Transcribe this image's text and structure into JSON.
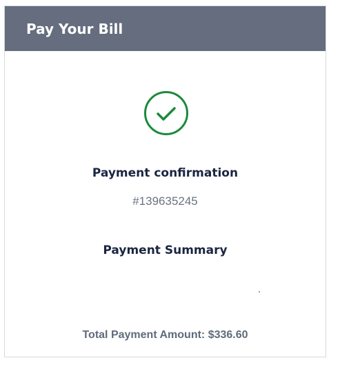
{
  "header": {
    "title": "Pay Your Bill"
  },
  "confirmation": {
    "icon": "check-circle-icon",
    "label": "Payment confirmation",
    "number": "#139635245"
  },
  "summary": {
    "label": "Payment Summary"
  },
  "total": {
    "text": "Total Payment Amount: $336.60"
  },
  "colors": {
    "header_bg": "#656d7e",
    "success_green": "#1a8a3c",
    "heading_navy": "#1b2541",
    "muted_gray": "#6b7280"
  }
}
